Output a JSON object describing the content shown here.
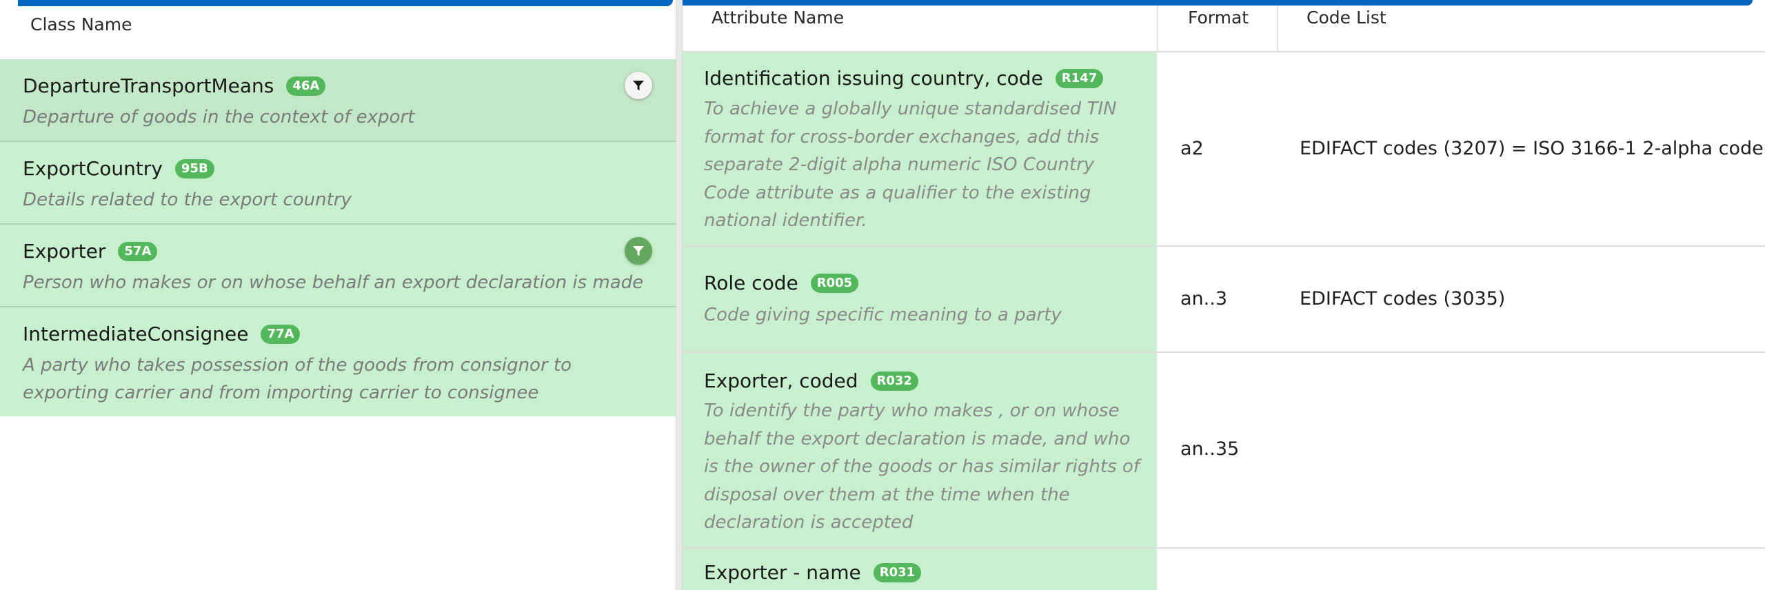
{
  "class_panel": {
    "header": "Class Name",
    "rows": [
      {
        "name": "DepartureTransportMeans",
        "badge": "46A",
        "description": "Departure of goods in the context of export",
        "filter_icon": "filter-icon",
        "selected": true
      },
      {
        "name": "ExportCountry",
        "badge": "95B",
        "description": "Details related to the export country"
      },
      {
        "name": "Exporter",
        "badge": "57A",
        "description": "Person who makes or on whose behalf an export declaration is made",
        "filter_icon": "filter-icon"
      },
      {
        "name": "IntermediateConsignee",
        "badge": "77A",
        "description": "A party who takes possession of the goods from consignor to exporting carrier and from importing carrier to consignee"
      }
    ]
  },
  "attribute_panel": {
    "headers": {
      "attribute_name": "Attribute Name",
      "format": "Format",
      "code_list": "Code List"
    },
    "rows": [
      {
        "name": "Identification issuing country, code",
        "badge": "R147",
        "description": "To achieve a globally unique standardised TIN format for cross-border exchanges, add this separate 2-digit alpha numeric ISO Country Code attribute as a qualifier to the existing national identifier.",
        "format": "a2",
        "code_list": "EDIFACT codes (3207) = ISO 3166-1 2-alpha code"
      },
      {
        "name": "Role code",
        "badge": "R005",
        "description": "Code giving specific meaning to a party",
        "format": "an..3",
        "code_list": "EDIFACT codes (3035)"
      },
      {
        "name": "Exporter, coded",
        "badge": "R032",
        "description": "To identify the party who makes , or on whose behalf the export declaration is made, and who is the owner of the goods or has similar rights of disposal over them at the time when the declaration is accepted",
        "format": "an..35",
        "code_list": ""
      },
      {
        "name": "Exporter - name",
        "badge": "R031",
        "description": "",
        "format": "",
        "code_list": ""
      }
    ]
  },
  "colors": {
    "accent_bar": "#0066c0",
    "row_green": "#c9f0ce",
    "badge_green": "#53b85c",
    "filter_green": "#64a85f"
  }
}
